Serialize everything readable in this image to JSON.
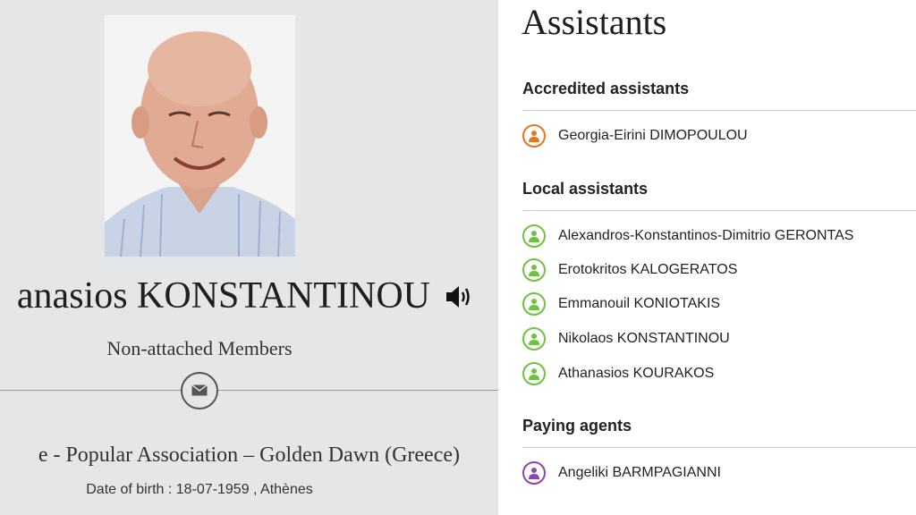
{
  "profile": {
    "name": "anasios KONSTANTINOU",
    "group": "Non-attached Members",
    "party": "e - Popular Association – Golden Dawn (Greece)",
    "dob": "Date of birth : 18-07-1959 , Athènes"
  },
  "assistants": {
    "title": "Assistants",
    "accredited": {
      "title": "Accredited assistants",
      "color": "#e8741e",
      "people": [
        "Georgia-Eirini DIMOPOULOU"
      ]
    },
    "local": {
      "title": "Local assistants",
      "color": "#6ec33c",
      "people": [
        "Alexandros-Konstantinos-Dimitrio GERONTAS",
        "Erotokritos KALOGERATOS",
        "Emmanouil KONIOTAKIS",
        "Nikolaos KONSTANTINOU",
        "Athanasios KOURAKOS"
      ]
    },
    "paying": {
      "title": "Paying agents",
      "color": "#8e44ad",
      "people": [
        "Angeliki BARMPAGIANNI"
      ]
    }
  },
  "icons": {
    "sound": "speaker-icon",
    "mail": "envelope-icon",
    "avatar": "person-icon"
  }
}
